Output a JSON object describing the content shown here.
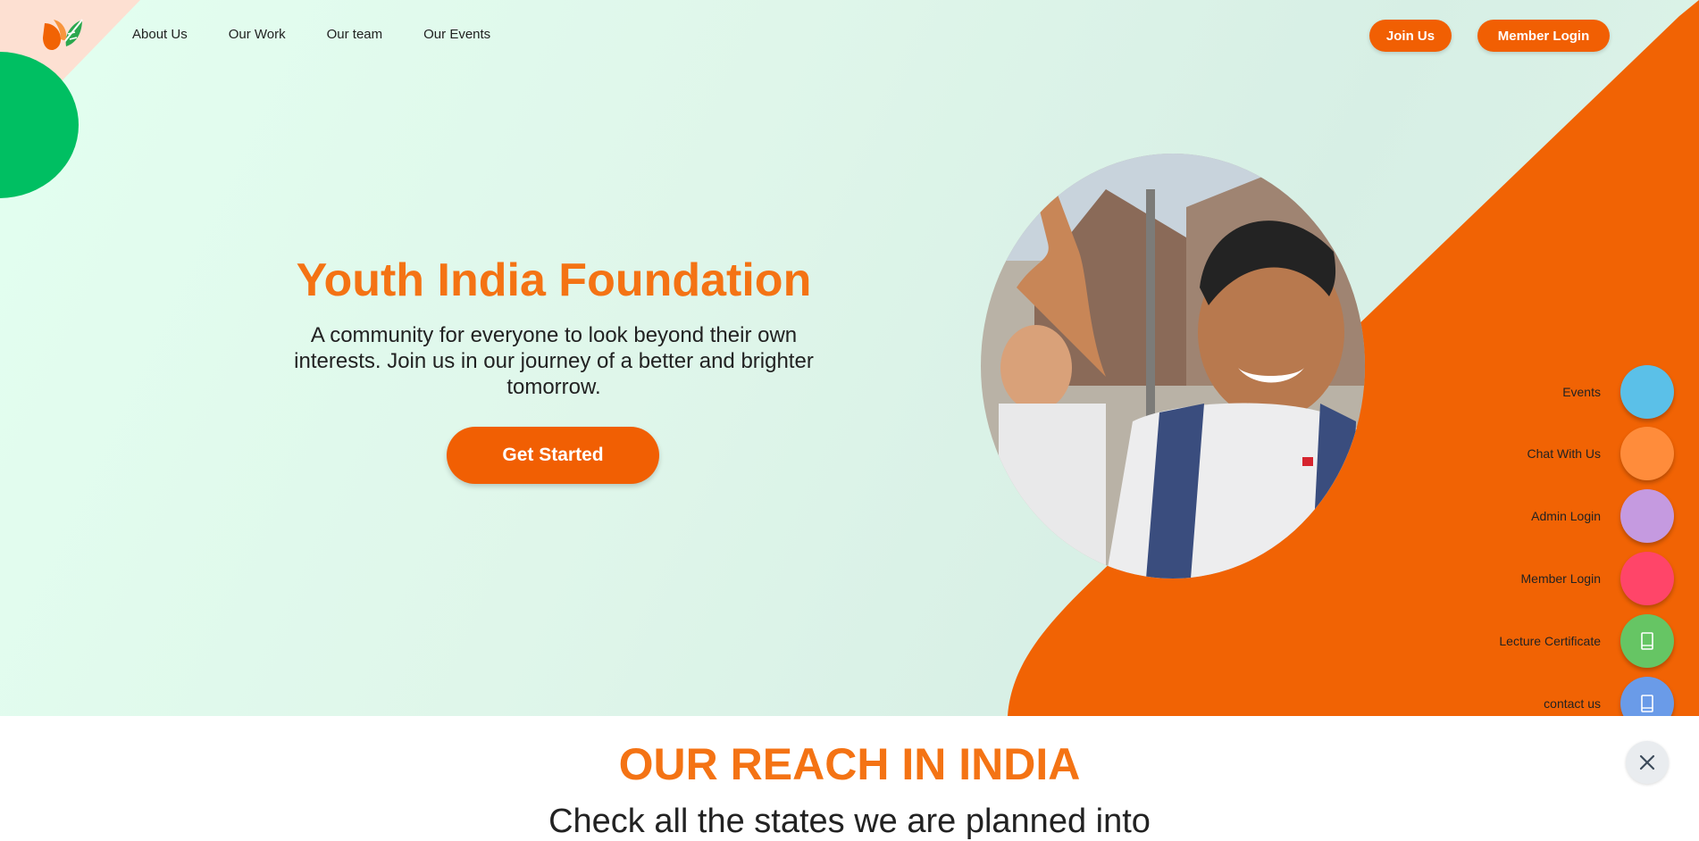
{
  "brand": {
    "orange": "#f15f03",
    "title_orange": "#f47314",
    "green": "#00bf62"
  },
  "nav": {
    "items": [
      {
        "label": "About Us"
      },
      {
        "label": "Our Work"
      },
      {
        "label": "Our team"
      },
      {
        "label": "Our Events"
      }
    ],
    "join_label": "Join Us",
    "member_login_label": "Member Login"
  },
  "hero": {
    "title": "Youth India Foundation",
    "subtitle": "A community for everyone to look beyond their own interests. Join us in our journey of a better and brighter tomorrow.",
    "cta_label": "Get Started"
  },
  "floating_menu": {
    "items": [
      {
        "label": "Events",
        "color": "#5bc0e8",
        "icon": ""
      },
      {
        "label": "Chat With Us",
        "color": "#ff8c3b",
        "icon": ""
      },
      {
        "label": "Admin Login",
        "color": "#c59ae0",
        "icon": ""
      },
      {
        "label": "Member Login",
        "color": "#ff4569",
        "icon": ""
      },
      {
        "label": "Lecture Certificate",
        "color": "#66c564",
        "icon": "mobile-icon"
      },
      {
        "label": "contact us",
        "color": "#6a9be8",
        "icon": "mobile-icon"
      }
    ],
    "close_icon": "close-icon"
  },
  "reach": {
    "title": "OUR REACH IN INDIA",
    "subtitle": "Check all the states we are planned into"
  }
}
